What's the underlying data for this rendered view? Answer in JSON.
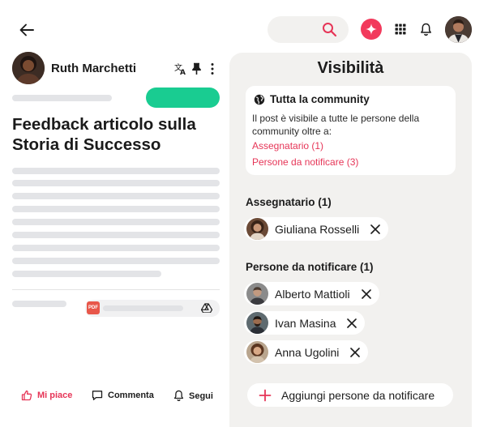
{
  "topbar": {
    "back_icon": "arrow-left-icon",
    "search_icon": "search-icon",
    "ai_icon": "sparkle-icon",
    "ai_color": "#f23a5c",
    "apps_icon": "grid-icon",
    "notifications_icon": "bell-icon",
    "profile_avatar": "avatar"
  },
  "post": {
    "author": "Ruth Marchetti",
    "translate_icon": "translate-icon",
    "pin_icon": "pin-icon",
    "more_icon": "more-vertical-icon",
    "tag_color": "#19cc91",
    "title": "Feedback articolo sulla Storia di Successo",
    "attachment": {
      "type_label": "PDF",
      "drive_icon": "google-drive-icon"
    },
    "actions": {
      "like": "Mi piace",
      "comment": "Commenta",
      "follow": "Segui"
    },
    "accent_color": "#e63557"
  },
  "visibility": {
    "title": "Visibilità",
    "audience": {
      "label": "Tutta la community",
      "icon": "globe-icon",
      "description": "Il post è visibile a tutte le persone della community oltre a:",
      "links": [
        "Assegnatario (1)",
        "Persone da notificare (3)"
      ]
    },
    "assignee_section": {
      "title": "Assegnatario (1)",
      "people": [
        {
          "name": "Giuliana Rosselli"
        }
      ]
    },
    "notify_section": {
      "title": "Persone da notificare (1)",
      "people": [
        {
          "name": "Alberto Mattioli"
        },
        {
          "name": "Ivan Masina"
        },
        {
          "name": "Anna Ugolini"
        }
      ]
    },
    "add_button": "Aggiungi persone da notificare"
  }
}
